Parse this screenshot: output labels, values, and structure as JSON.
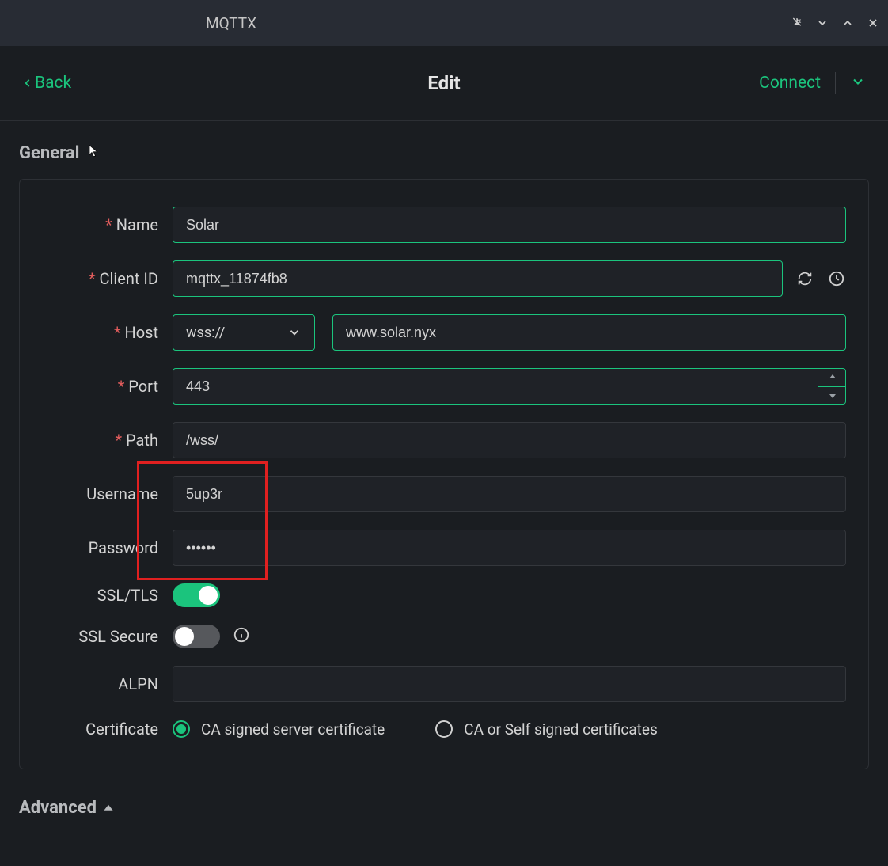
{
  "titlebar": {
    "app_name": "MQTTX"
  },
  "header": {
    "back_label": "Back",
    "title": "Edit",
    "connect_label": "Connect"
  },
  "section": {
    "general": "General",
    "advanced": "Advanced"
  },
  "labels": {
    "name": "Name",
    "client_id": "Client ID",
    "host": "Host",
    "port": "Port",
    "path": "Path",
    "username": "Username",
    "password": "Password",
    "ssl": "SSL/TLS",
    "ssl_secure": "SSL Secure",
    "alpn": "ALPN",
    "certificate": "Certificate"
  },
  "values": {
    "name": "Solar",
    "client_id": "mqttx_11874fb8",
    "protocol": "wss://",
    "host": "www.solar.nyx",
    "port": "443",
    "path": "/wss/",
    "username": "5up3r",
    "password": "••••••",
    "ssl": true,
    "ssl_secure": false,
    "alpn": ""
  },
  "cert": {
    "ca_signed": "CA signed server certificate",
    "self_signed": "CA or Self signed certificates",
    "selected": "ca_signed"
  }
}
